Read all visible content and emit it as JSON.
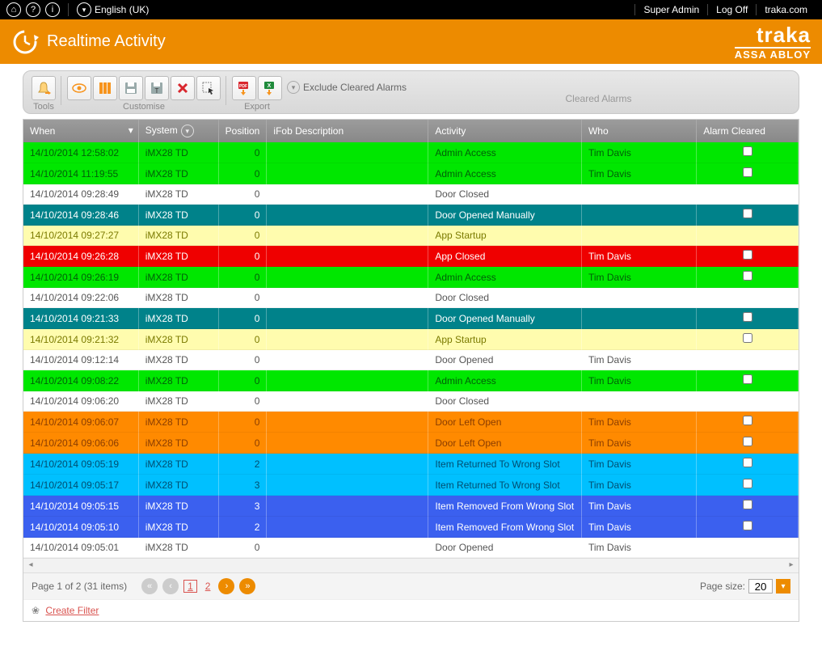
{
  "topbar": {
    "language": "English (UK)",
    "links": [
      "Super Admin",
      "Log Off",
      "traka.com"
    ]
  },
  "header": {
    "title": "Realtime Activity",
    "brand1": "traka",
    "brand2": "ASSA ABLOY"
  },
  "toolbar": {
    "groups": {
      "tools": "Tools",
      "customise": "Customise",
      "export": "Export"
    },
    "exclude_label": "Exclude Cleared Alarms",
    "cleared_label": "Cleared Alarms"
  },
  "grid": {
    "columns": {
      "when": "When",
      "system": "System",
      "position": "Position",
      "ifob": "iFob Description",
      "activity": "Activity",
      "who": "Who",
      "alarm": "Alarm Cleared"
    },
    "rows": [
      {
        "when": "14/10/2014 12:58:02",
        "system": "iMX28 TD",
        "position": "0",
        "ifob": "",
        "activity": "Admin Access",
        "who": "Tim Davis",
        "alarm": true,
        "cls": "c-green"
      },
      {
        "when": "14/10/2014 11:19:55",
        "system": "iMX28 TD",
        "position": "0",
        "ifob": "",
        "activity": "Admin Access",
        "who": "Tim Davis",
        "alarm": true,
        "cls": "c-green"
      },
      {
        "when": "14/10/2014 09:28:49",
        "system": "iMX28 TD",
        "position": "0",
        "ifob": "",
        "activity": "Door Closed",
        "who": "",
        "alarm": false,
        "cls": "c-white"
      },
      {
        "when": "14/10/2014 09:28:46",
        "system": "iMX28 TD",
        "position": "0",
        "ifob": "",
        "activity": "Door Opened Manually",
        "who": "",
        "alarm": true,
        "cls": "c-teal"
      },
      {
        "when": "14/10/2014 09:27:27",
        "system": "iMX28 TD",
        "position": "0",
        "ifob": "",
        "activity": "App Startup",
        "who": "",
        "alarm": false,
        "cls": "c-yellow"
      },
      {
        "when": "14/10/2014 09:26:28",
        "system": "iMX28 TD",
        "position": "0",
        "ifob": "",
        "activity": "App Closed",
        "who": "Tim Davis",
        "alarm": true,
        "cls": "c-red"
      },
      {
        "when": "14/10/2014 09:26:19",
        "system": "iMX28 TD",
        "position": "0",
        "ifob": "",
        "activity": "Admin Access",
        "who": "Tim Davis",
        "alarm": true,
        "cls": "c-green"
      },
      {
        "when": "14/10/2014 09:22:06",
        "system": "iMX28 TD",
        "position": "0",
        "ifob": "",
        "activity": "Door Closed",
        "who": "",
        "alarm": false,
        "cls": "c-white"
      },
      {
        "when": "14/10/2014 09:21:33",
        "system": "iMX28 TD",
        "position": "0",
        "ifob": "",
        "activity": "Door Opened Manually",
        "who": "",
        "alarm": true,
        "cls": "c-teal"
      },
      {
        "when": "14/10/2014 09:21:32",
        "system": "iMX28 TD",
        "position": "0",
        "ifob": "",
        "activity": "App Startup",
        "who": "",
        "alarm": true,
        "cls": "c-yellow"
      },
      {
        "when": "14/10/2014 09:12:14",
        "system": "iMX28 TD",
        "position": "0",
        "ifob": "",
        "activity": "Door Opened",
        "who": "Tim Davis",
        "alarm": false,
        "cls": "c-white"
      },
      {
        "when": "14/10/2014 09:08:22",
        "system": "iMX28 TD",
        "position": "0",
        "ifob": "",
        "activity": "Admin Access",
        "who": "Tim Davis",
        "alarm": true,
        "cls": "c-green"
      },
      {
        "when": "14/10/2014 09:06:20",
        "system": "iMX28 TD",
        "position": "0",
        "ifob": "",
        "activity": "Door Closed",
        "who": "",
        "alarm": false,
        "cls": "c-white"
      },
      {
        "when": "14/10/2014 09:06:07",
        "system": "iMX28 TD",
        "position": "0",
        "ifob": "",
        "activity": "Door Left Open",
        "who": "Tim Davis",
        "alarm": true,
        "cls": "c-orange"
      },
      {
        "when": "14/10/2014 09:06:06",
        "system": "iMX28 TD",
        "position": "0",
        "ifob": "",
        "activity": "Door Left Open",
        "who": "Tim Davis",
        "alarm": true,
        "cls": "c-orange"
      },
      {
        "when": "14/10/2014 09:05:19",
        "system": "iMX28 TD",
        "position": "2",
        "ifob": "",
        "activity": "Item Returned To Wrong Slot",
        "who": "Tim Davis",
        "alarm": true,
        "cls": "c-cyan"
      },
      {
        "when": "14/10/2014 09:05:17",
        "system": "iMX28 TD",
        "position": "3",
        "ifob": "",
        "activity": "Item Returned To Wrong Slot",
        "who": "Tim Davis",
        "alarm": true,
        "cls": "c-cyan"
      },
      {
        "when": "14/10/2014 09:05:15",
        "system": "iMX28 TD",
        "position": "3",
        "ifob": "",
        "activity": "Item Removed From Wrong Slot",
        "who": "Tim Davis",
        "alarm": true,
        "cls": "c-blue"
      },
      {
        "when": "14/10/2014 09:05:10",
        "system": "iMX28 TD",
        "position": "2",
        "ifob": "",
        "activity": "Item Removed From Wrong Slot",
        "who": "Tim Davis",
        "alarm": true,
        "cls": "c-blue"
      },
      {
        "when": "14/10/2014 09:05:01",
        "system": "iMX28 TD",
        "position": "0",
        "ifob": "",
        "activity": "Door Opened",
        "who": "Tim Davis",
        "alarm": false,
        "cls": "c-white"
      }
    ]
  },
  "pager": {
    "summary": "Page 1 of 2 (31 items)",
    "pages": [
      "1",
      "2"
    ],
    "current": "1",
    "size_label": "Page size:",
    "size_value": "20"
  },
  "filter": {
    "create": "Create Filter"
  }
}
